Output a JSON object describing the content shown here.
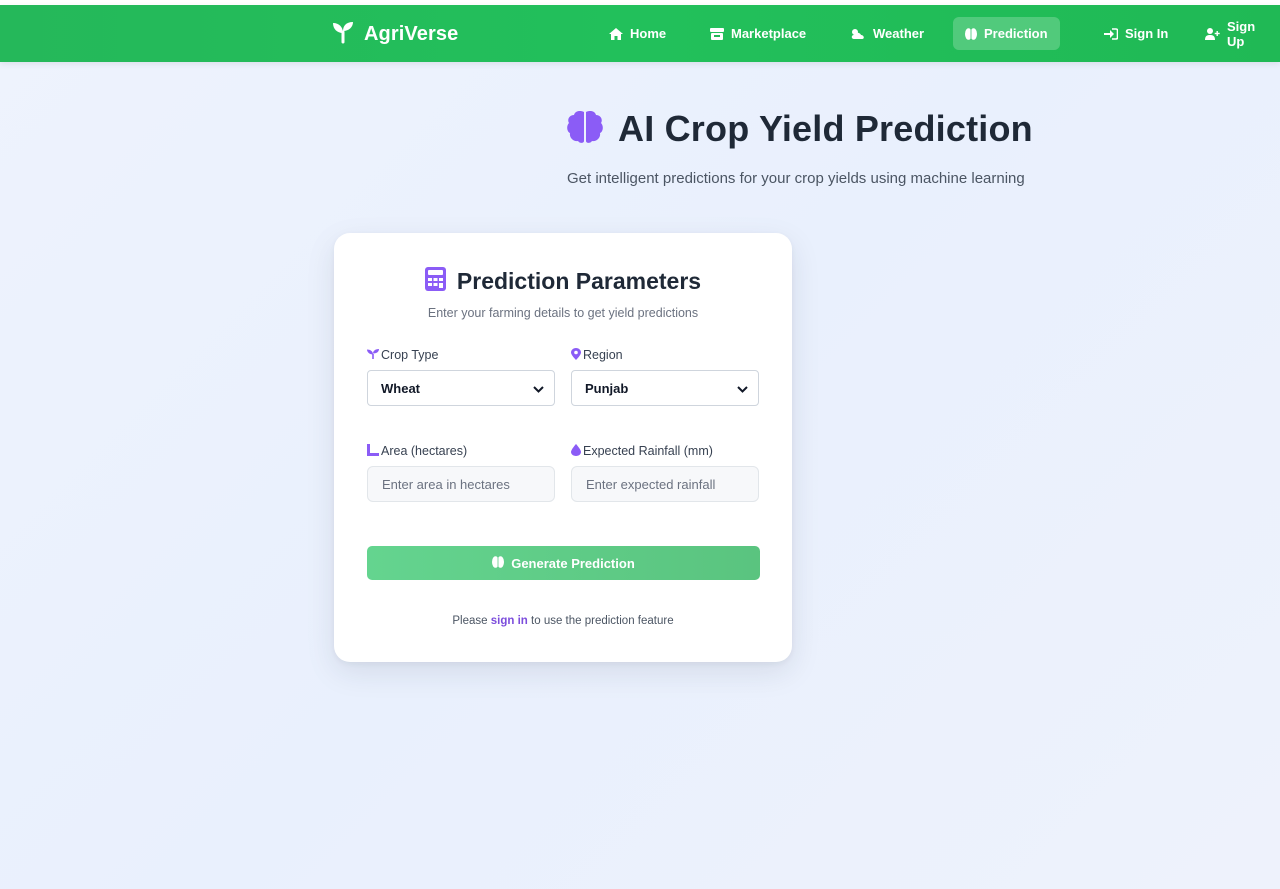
{
  "brand": {
    "name": "AgriVerse"
  },
  "nav": {
    "items": [
      {
        "label": "Home",
        "icon": "home-icon"
      },
      {
        "label": "Marketplace",
        "icon": "store-icon"
      },
      {
        "label": "Weather",
        "icon": "cloud-sun-icon"
      },
      {
        "label": "Prediction",
        "icon": "brain-icon",
        "active": true
      },
      {
        "label": "Sign In",
        "icon": "sign-in-icon"
      },
      {
        "label": "Sign Up",
        "icon": "user-plus-icon"
      }
    ]
  },
  "hero": {
    "title": "AI Crop Yield Prediction",
    "subtitle": "Get intelligent predictions for your crop yields using machine learning",
    "icon": "brain-icon"
  },
  "form": {
    "title": "Prediction Parameters",
    "subtitle": "Enter your farming details to get yield predictions",
    "icon": "calculator-icon",
    "crop": {
      "label": "Crop Type",
      "value": "Wheat",
      "icon": "seedling-icon"
    },
    "region": {
      "label": "Region",
      "value": "Punjab",
      "icon": "map-pin-icon"
    },
    "area": {
      "label": "Area (hectares)",
      "placeholder": "Enter area in hectares",
      "icon": "ruler-icon"
    },
    "rainfall": {
      "label": "Expected Rainfall (mm)",
      "placeholder": "Enter expected rainfall",
      "icon": "droplet-icon"
    },
    "submit_label": "Generate Prediction",
    "note_before": "Please",
    "note_link": "sign in",
    "note_after": "to use the prediction feature"
  },
  "colors": {
    "nav_green": "#22c05b",
    "accent_purple": "#8b5cf6",
    "button_green": "#5fcc87",
    "link_purple": "#7c4ddc"
  }
}
